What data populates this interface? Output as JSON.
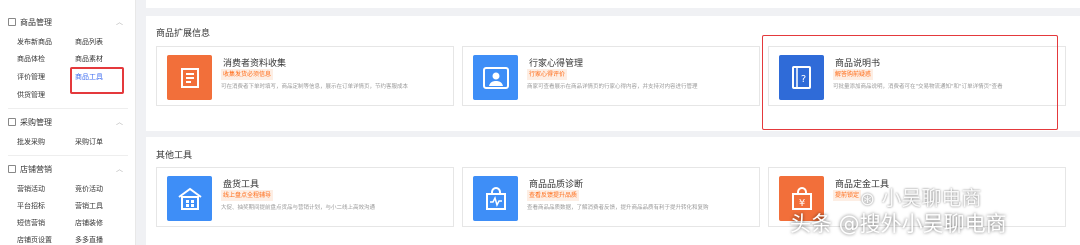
{
  "sidebar": {
    "goods": {
      "title": "商品管理",
      "items": [
        "发布新商品",
        "商品列表",
        "商品体检",
        "商品素材",
        "评价管理",
        "商品工具",
        "供货管理"
      ]
    },
    "purchase": {
      "title": "采购管理",
      "items": [
        "批发采购",
        "采购订单"
      ]
    },
    "store": {
      "title": "店铺营销",
      "items": [
        "营销活动",
        "竞价活动",
        "平台招标",
        "营销工具",
        "短信营销",
        "店铺装修",
        "店铺页设置",
        "多多直播"
      ]
    }
  },
  "ext_section": {
    "title": "商品扩展信息",
    "cards": [
      {
        "name": "消费者资料收集",
        "tag": "收集发货必须信息",
        "desc": "可在消费者下单时填写，商品定制等信息，展示在订单详情页，节约客服成本",
        "color": "#f26f3a",
        "icon": "doc-icon"
      },
      {
        "name": "行家心得管理",
        "tag": "行家心得评价",
        "desc": "商家可查看展示在商品详情页的行家心得内容，并支持对内容进行管理",
        "color": "#3e8ef7",
        "icon": "user-card-icon"
      },
      {
        "name": "商品说明书",
        "tag": "解答购前疑惑",
        "desc": "可批量添加商品说明，消费者可在\"交易物流通知\"和\"订单详情页\"查看",
        "color": "#2f6bd8",
        "icon": "manual-icon"
      }
    ]
  },
  "other_section": {
    "title": "其他工具",
    "cards": [
      {
        "name": "盘货工具",
        "tag": "线上盘点全程辅导",
        "desc": "大促、抽奖期间提前盘点货品与营销计划，与小二线上高效沟通",
        "color": "#3e8ef7",
        "icon": "store-icon"
      },
      {
        "name": "商品品质诊断",
        "tag": "查看反馈提升品质",
        "desc": "查看商品品质数据，了解消费者反馈，提升商品品质有利于提升转化和复购",
        "color": "#3e8ef7",
        "icon": "bag-pulse-icon"
      },
      {
        "name": "商品定金工具",
        "tag": "提前锁定",
        "desc": "",
        "color": "#f26f3a",
        "icon": "yen-bag-icon"
      }
    ]
  },
  "watermarks": {
    "top": "小吴聊电商",
    "bottom": "头条 @搜外小吴聊电商"
  }
}
